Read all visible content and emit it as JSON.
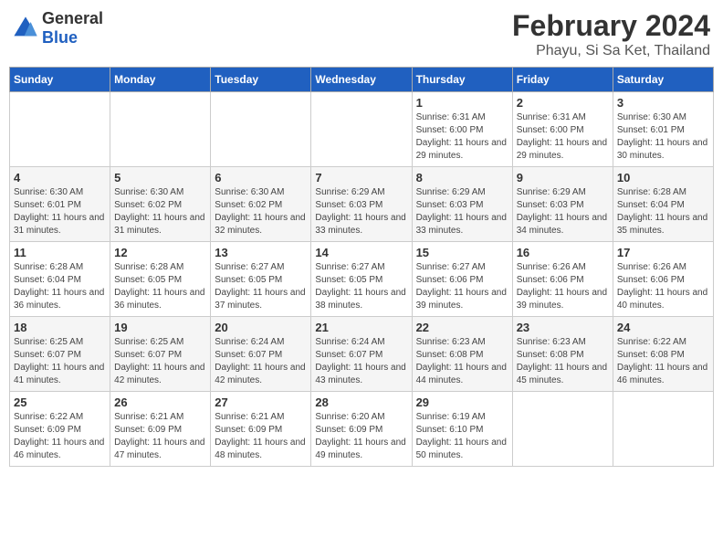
{
  "logo": {
    "text_general": "General",
    "text_blue": "Blue"
  },
  "title": {
    "month_year": "February 2024",
    "location": "Phayu, Si Sa Ket, Thailand"
  },
  "weekdays": [
    "Sunday",
    "Monday",
    "Tuesday",
    "Wednesday",
    "Thursday",
    "Friday",
    "Saturday"
  ],
  "weeks": [
    [
      {
        "day": "",
        "detail": ""
      },
      {
        "day": "",
        "detail": ""
      },
      {
        "day": "",
        "detail": ""
      },
      {
        "day": "",
        "detail": ""
      },
      {
        "day": "1",
        "detail": "Sunrise: 6:31 AM\nSunset: 6:00 PM\nDaylight: 11 hours\nand 29 minutes."
      },
      {
        "day": "2",
        "detail": "Sunrise: 6:31 AM\nSunset: 6:00 PM\nDaylight: 11 hours\nand 29 minutes."
      },
      {
        "day": "3",
        "detail": "Sunrise: 6:30 AM\nSunset: 6:01 PM\nDaylight: 11 hours\nand 30 minutes."
      }
    ],
    [
      {
        "day": "4",
        "detail": "Sunrise: 6:30 AM\nSunset: 6:01 PM\nDaylight: 11 hours\nand 31 minutes."
      },
      {
        "day": "5",
        "detail": "Sunrise: 6:30 AM\nSunset: 6:02 PM\nDaylight: 11 hours\nand 31 minutes."
      },
      {
        "day": "6",
        "detail": "Sunrise: 6:30 AM\nSunset: 6:02 PM\nDaylight: 11 hours\nand 32 minutes."
      },
      {
        "day": "7",
        "detail": "Sunrise: 6:29 AM\nSunset: 6:03 PM\nDaylight: 11 hours\nand 33 minutes."
      },
      {
        "day": "8",
        "detail": "Sunrise: 6:29 AM\nSunset: 6:03 PM\nDaylight: 11 hours\nand 33 minutes."
      },
      {
        "day": "9",
        "detail": "Sunrise: 6:29 AM\nSunset: 6:03 PM\nDaylight: 11 hours\nand 34 minutes."
      },
      {
        "day": "10",
        "detail": "Sunrise: 6:28 AM\nSunset: 6:04 PM\nDaylight: 11 hours\nand 35 minutes."
      }
    ],
    [
      {
        "day": "11",
        "detail": "Sunrise: 6:28 AM\nSunset: 6:04 PM\nDaylight: 11 hours\nand 36 minutes."
      },
      {
        "day": "12",
        "detail": "Sunrise: 6:28 AM\nSunset: 6:05 PM\nDaylight: 11 hours\nand 36 minutes."
      },
      {
        "day": "13",
        "detail": "Sunrise: 6:27 AM\nSunset: 6:05 PM\nDaylight: 11 hours\nand 37 minutes."
      },
      {
        "day": "14",
        "detail": "Sunrise: 6:27 AM\nSunset: 6:05 PM\nDaylight: 11 hours\nand 38 minutes."
      },
      {
        "day": "15",
        "detail": "Sunrise: 6:27 AM\nSunset: 6:06 PM\nDaylight: 11 hours\nand 39 minutes."
      },
      {
        "day": "16",
        "detail": "Sunrise: 6:26 AM\nSunset: 6:06 PM\nDaylight: 11 hours\nand 39 minutes."
      },
      {
        "day": "17",
        "detail": "Sunrise: 6:26 AM\nSunset: 6:06 PM\nDaylight: 11 hours\nand 40 minutes."
      }
    ],
    [
      {
        "day": "18",
        "detail": "Sunrise: 6:25 AM\nSunset: 6:07 PM\nDaylight: 11 hours\nand 41 minutes."
      },
      {
        "day": "19",
        "detail": "Sunrise: 6:25 AM\nSunset: 6:07 PM\nDaylight: 11 hours\nand 42 minutes."
      },
      {
        "day": "20",
        "detail": "Sunrise: 6:24 AM\nSunset: 6:07 PM\nDaylight: 11 hours\nand 42 minutes."
      },
      {
        "day": "21",
        "detail": "Sunrise: 6:24 AM\nSunset: 6:07 PM\nDaylight: 11 hours\nand 43 minutes."
      },
      {
        "day": "22",
        "detail": "Sunrise: 6:23 AM\nSunset: 6:08 PM\nDaylight: 11 hours\nand 44 minutes."
      },
      {
        "day": "23",
        "detail": "Sunrise: 6:23 AM\nSunset: 6:08 PM\nDaylight: 11 hours\nand 45 minutes."
      },
      {
        "day": "24",
        "detail": "Sunrise: 6:22 AM\nSunset: 6:08 PM\nDaylight: 11 hours\nand 46 minutes."
      }
    ],
    [
      {
        "day": "25",
        "detail": "Sunrise: 6:22 AM\nSunset: 6:09 PM\nDaylight: 11 hours\nand 46 minutes."
      },
      {
        "day": "26",
        "detail": "Sunrise: 6:21 AM\nSunset: 6:09 PM\nDaylight: 11 hours\nand 47 minutes."
      },
      {
        "day": "27",
        "detail": "Sunrise: 6:21 AM\nSunset: 6:09 PM\nDaylight: 11 hours\nand 48 minutes."
      },
      {
        "day": "28",
        "detail": "Sunrise: 6:20 AM\nSunset: 6:09 PM\nDaylight: 11 hours\nand 49 minutes."
      },
      {
        "day": "29",
        "detail": "Sunrise: 6:19 AM\nSunset: 6:10 PM\nDaylight: 11 hours\nand 50 minutes."
      },
      {
        "day": "",
        "detail": ""
      },
      {
        "day": "",
        "detail": ""
      }
    ]
  ]
}
